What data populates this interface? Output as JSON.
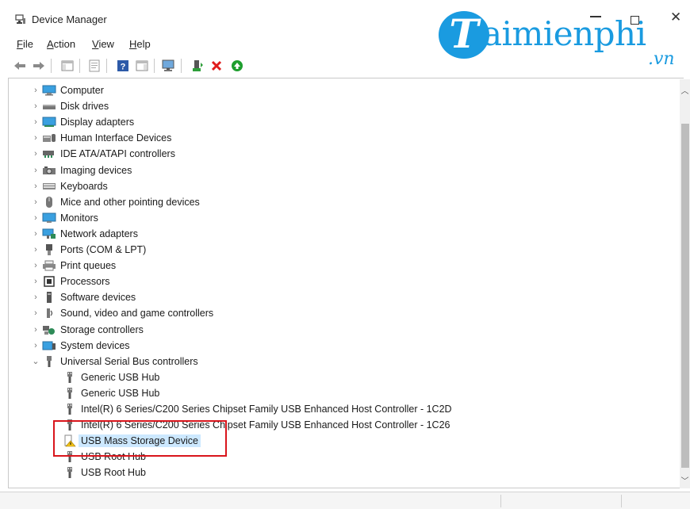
{
  "window": {
    "title": "Device Manager"
  },
  "watermark": {
    "letter": "T",
    "brand": "aimienphi",
    "sub": ".vn"
  },
  "menu": [
    {
      "label": "File"
    },
    {
      "label": "Action"
    },
    {
      "label": "View"
    },
    {
      "label": "Help"
    }
  ],
  "toolbar": [
    {
      "icon": "back-arrow-icon"
    },
    {
      "icon": "forward-arrow-icon"
    },
    {
      "icon": "show-hide-console-tree-icon"
    },
    {
      "icon": "properties-icon"
    },
    {
      "icon": "help-icon"
    },
    {
      "icon": "action-pane-icon"
    },
    {
      "icon": "scan-hardware-changes-icon"
    },
    {
      "icon": "update-driver-icon"
    },
    {
      "icon": "uninstall-device-icon"
    },
    {
      "icon": "enable-device-icon"
    }
  ],
  "tree": {
    "categories": [
      {
        "label": "Computer",
        "icon": "computer-icon",
        "expanded": false
      },
      {
        "label": "Disk drives",
        "icon": "disk-drive-icon",
        "expanded": false
      },
      {
        "label": "Display adapters",
        "icon": "display-adapter-icon",
        "expanded": false
      },
      {
        "label": "Human Interface Devices",
        "icon": "hid-icon",
        "expanded": false
      },
      {
        "label": "IDE ATA/ATAPI controllers",
        "icon": "ide-controller-icon",
        "expanded": false
      },
      {
        "label": "Imaging devices",
        "icon": "imaging-device-icon",
        "expanded": false
      },
      {
        "label": "Keyboards",
        "icon": "keyboard-icon",
        "expanded": false
      },
      {
        "label": "Mice and other pointing devices",
        "icon": "mouse-icon",
        "expanded": false
      },
      {
        "label": "Monitors",
        "icon": "monitor-icon",
        "expanded": false
      },
      {
        "label": "Network adapters",
        "icon": "network-adapter-icon",
        "expanded": false
      },
      {
        "label": "Ports (COM & LPT)",
        "icon": "port-icon",
        "expanded": false
      },
      {
        "label": "Print queues",
        "icon": "printer-icon",
        "expanded": false
      },
      {
        "label": "Processors",
        "icon": "processor-icon",
        "expanded": false
      },
      {
        "label": "Software devices",
        "icon": "software-device-icon",
        "expanded": false
      },
      {
        "label": "Sound, video and game controllers",
        "icon": "sound-icon",
        "expanded": false
      },
      {
        "label": "Storage controllers",
        "icon": "storage-controller-icon",
        "expanded": false
      },
      {
        "label": "System devices",
        "icon": "system-device-icon",
        "expanded": false
      },
      {
        "label": "Universal Serial Bus controllers",
        "icon": "usb-icon",
        "expanded": true
      }
    ],
    "usb_children": [
      {
        "label": "Generic USB Hub",
        "icon": "usb-plug-icon",
        "warning": false
      },
      {
        "label": "Generic USB Hub",
        "icon": "usb-plug-icon",
        "warning": false
      },
      {
        "label": "Intel(R) 6 Series/C200 Series Chipset Family USB Enhanced Host Controller - 1C2D",
        "icon": "usb-plug-icon",
        "warning": false
      },
      {
        "label": "Intel(R) 6 Series/C200 Series Chipset Family USB Enhanced Host Controller - 1C26",
        "icon": "usb-plug-icon",
        "warning": false
      },
      {
        "label": "USB Mass Storage Device",
        "icon": "usb-storage-warning-icon",
        "warning": true,
        "selected": true
      },
      {
        "label": "USB Root Hub",
        "icon": "usb-plug-icon",
        "warning": false
      },
      {
        "label": "USB Root Hub",
        "icon": "usb-plug-icon",
        "warning": false
      }
    ]
  },
  "colors": {
    "highlight_box": "#d9151c",
    "selection": "#cce8ff",
    "brand": "#1a9be0"
  }
}
